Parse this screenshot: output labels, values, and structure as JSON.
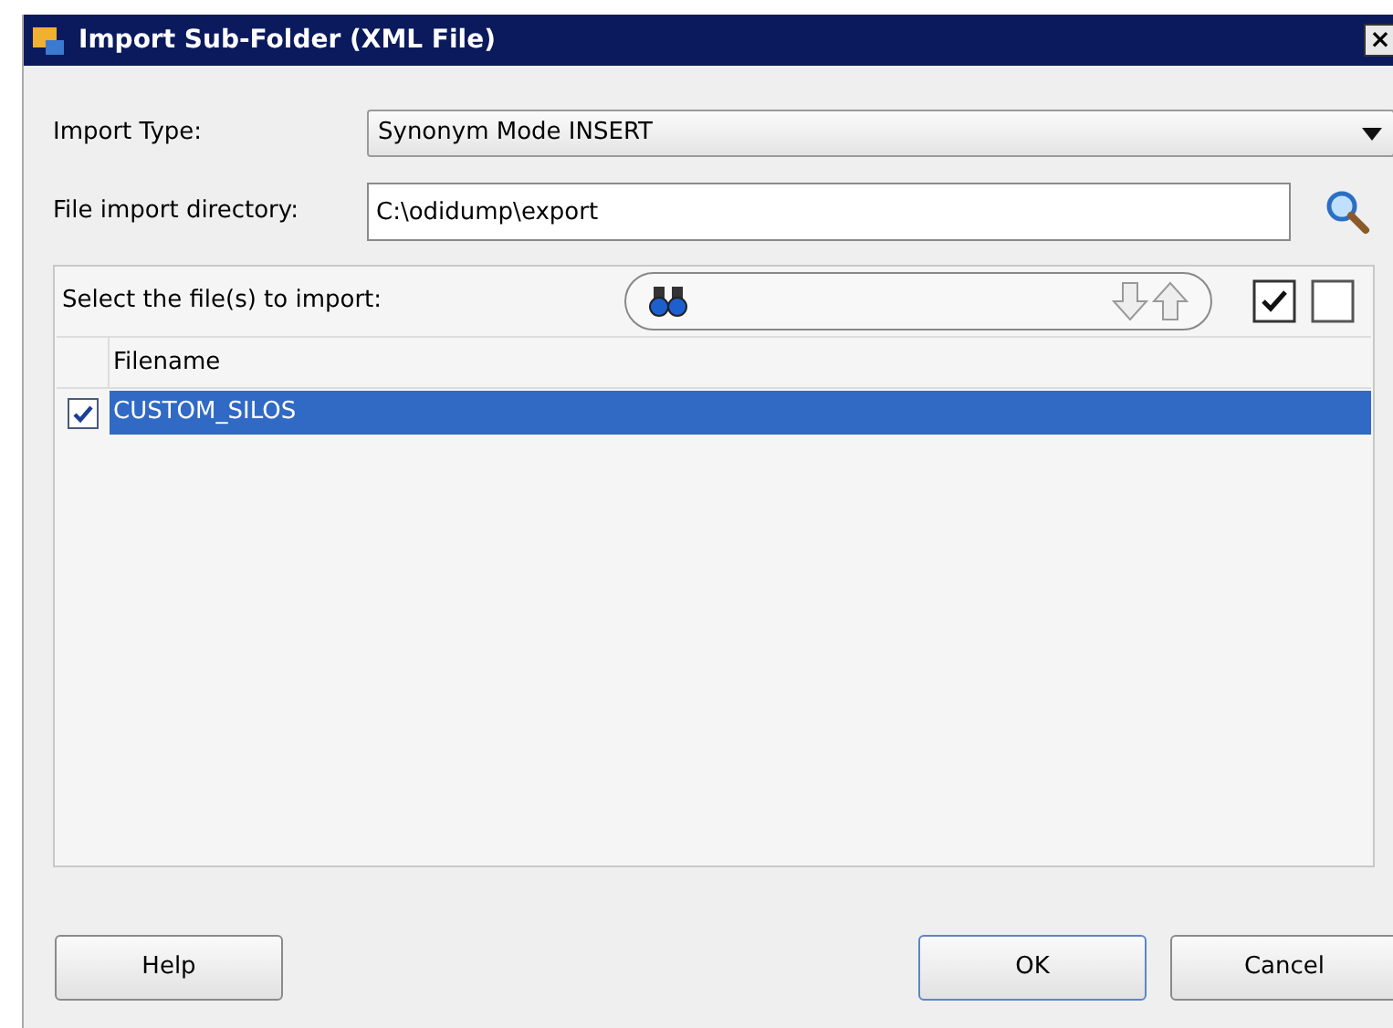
{
  "window": {
    "title": "Import Sub-Folder (XML File)",
    "close": "×"
  },
  "import_type": {
    "label": "Import Type:",
    "value": "Synonym Mode INSERT"
  },
  "directory": {
    "label": "File import directory:",
    "value": "C:\\odidump\\export"
  },
  "files": {
    "label": "Select the file(s) to import:",
    "columns": [
      "Filename"
    ],
    "rows": [
      {
        "filename": "CUSTOM_SILOS",
        "checked": true,
        "selected": true
      }
    ]
  },
  "buttons": [
    {
      "label": "Help",
      "kind": "left"
    },
    {
      "label": "OK",
      "kind": "default"
    },
    {
      "label": "Cancel",
      "kind": "plain"
    }
  ]
}
